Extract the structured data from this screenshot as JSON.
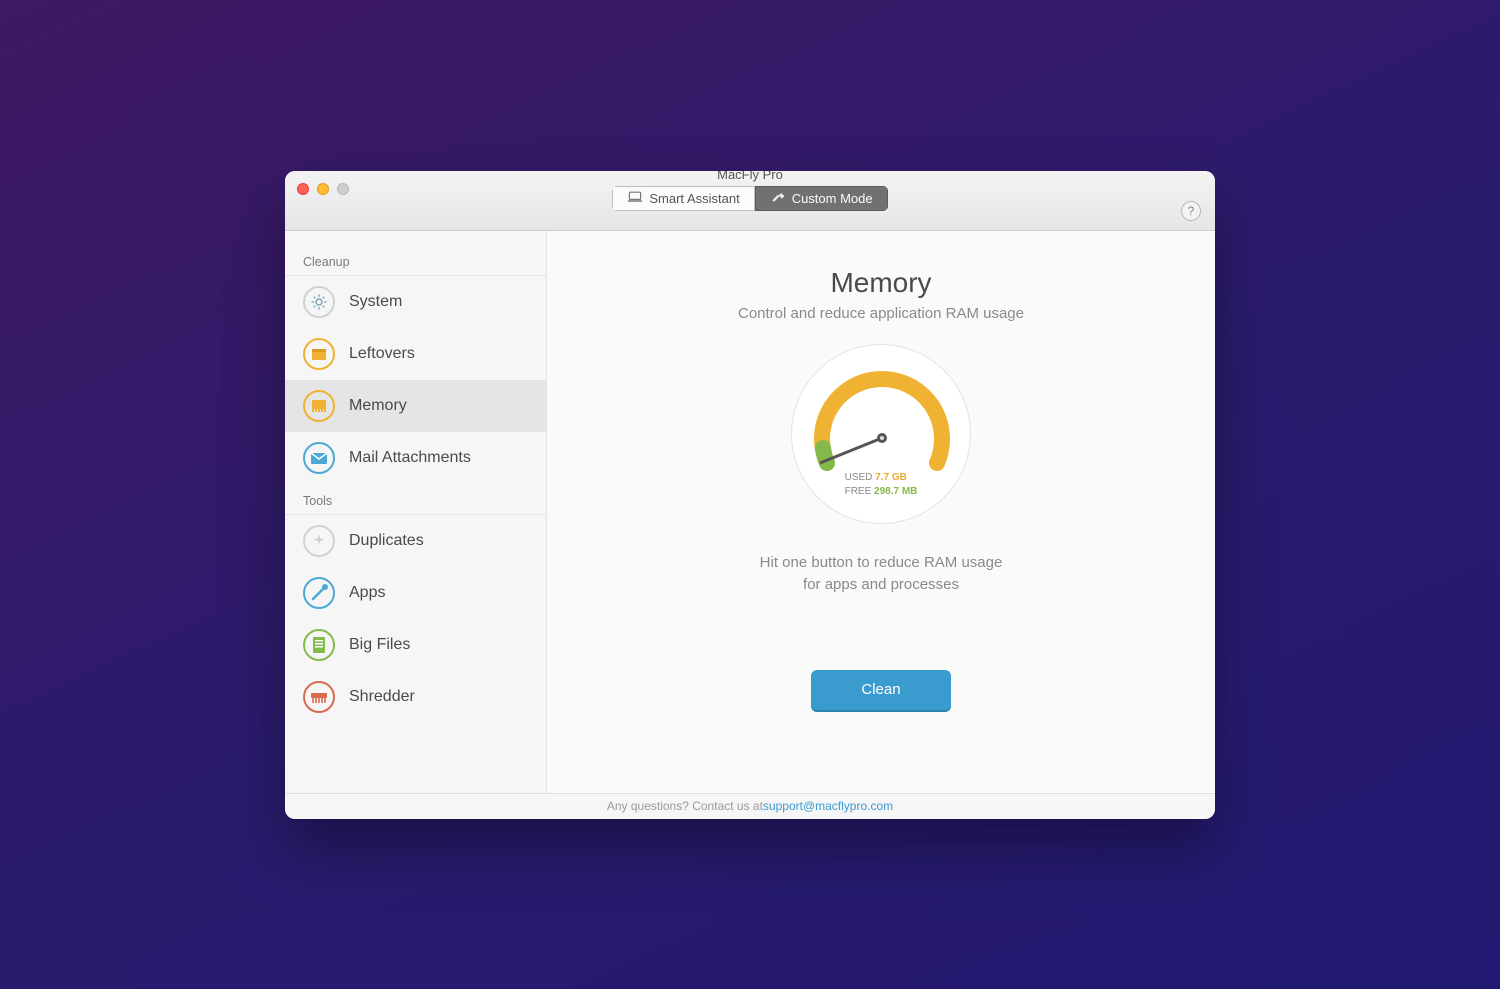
{
  "window": {
    "title": "MacFly Pro"
  },
  "tabs": {
    "smart": "Smart Assistant",
    "custom": "Custom Mode"
  },
  "help_tooltip": "?",
  "sidebar": {
    "sections": [
      {
        "title": "Cleanup",
        "items": [
          {
            "id": "system",
            "label": "System",
            "icon": "gear-icon",
            "selected": false
          },
          {
            "id": "leftovers",
            "label": "Leftovers",
            "icon": "box-icon",
            "selected": false
          },
          {
            "id": "memory",
            "label": "Memory",
            "icon": "chip-icon",
            "selected": true
          },
          {
            "id": "mail",
            "label": "Mail Attachments",
            "icon": "envelope-icon",
            "selected": false
          }
        ]
      },
      {
        "title": "Tools",
        "items": [
          {
            "id": "duplicates",
            "label": "Duplicates",
            "icon": "sparkle-icon",
            "selected": false
          },
          {
            "id": "apps",
            "label": "Apps",
            "icon": "tools-icon",
            "selected": false
          },
          {
            "id": "bigfiles",
            "label": "Big Files",
            "icon": "files-icon",
            "selected": false
          },
          {
            "id": "shredder",
            "label": "Shredder",
            "icon": "shred-icon",
            "selected": false
          }
        ]
      }
    ]
  },
  "main": {
    "heading": "Memory",
    "subheading": "Control and reduce application RAM usage",
    "gauge": {
      "used_label": "USED",
      "used_value": "7.7 GB",
      "free_label": "FREE",
      "free_value": "298.7 MB"
    },
    "hint_line1": "Hit one button to reduce RAM usage",
    "hint_line2": "for apps and processes",
    "action_label": "Clean"
  },
  "footer": {
    "prefix": "Any questions? Contact us at ",
    "email": "support@macflypro.com"
  },
  "colors": {
    "accent_blue": "#3a9bcf",
    "gauge_yellow": "#efb233",
    "gauge_green": "#86b94b"
  }
}
